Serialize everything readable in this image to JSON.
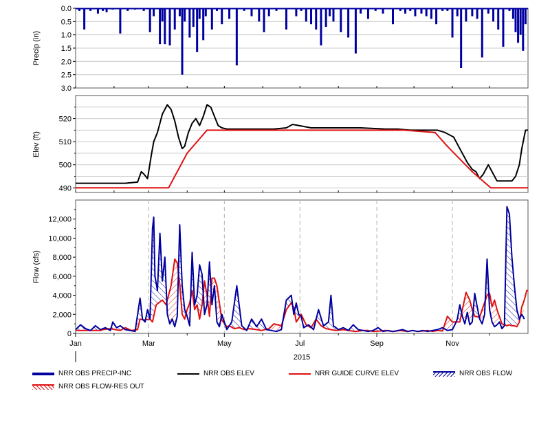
{
  "year_label": "2015",
  "x_months": [
    "Jan",
    "Mar",
    "May",
    "Jul",
    "Sep",
    "Nov"
  ],
  "legend": [
    {
      "label": "NRR OBS PRECIP-INC",
      "style": "thick-line",
      "color": "#0000a0"
    },
    {
      "label": "NRR OBS ELEV",
      "style": "line",
      "color": "#000000"
    },
    {
      "label": "NRR GUIDE CURVE ELEV",
      "style": "line",
      "color": "#e01010"
    },
    {
      "label": "NRR OBS FLOW",
      "style": "hatch",
      "color": "#0000a0"
    },
    {
      "label": "NRR OBS FLOW-RES OUT",
      "style": "hatch",
      "color": "#e01010"
    }
  ],
  "chart_data": [
    {
      "type": "bar",
      "ylabel": "Precip (in)",
      "y_inverted": true,
      "ylim": [
        0,
        3.0
      ],
      "yticks": [
        "0.0",
        "0.5",
        "1.0",
        "1.5",
        "2.0",
        "2.5",
        "3.0"
      ],
      "xlim_days": [
        0,
        365
      ],
      "color": "#0000a0",
      "x_day": [
        3,
        7,
        12,
        18,
        22,
        25,
        30,
        36,
        42,
        48,
        55,
        60,
        63,
        68,
        70,
        72,
        76,
        80,
        84,
        86,
        88,
        92,
        95,
        98,
        100,
        103,
        105,
        110,
        114,
        118,
        124,
        130,
        136,
        142,
        148,
        152,
        156,
        162,
        170,
        178,
        182,
        186,
        190,
        194,
        198,
        202,
        205,
        208,
        214,
        220,
        226,
        230,
        236,
        242,
        248,
        256,
        262,
        266,
        270,
        274,
        279,
        283,
        287,
        291,
        296,
        300,
        304,
        308,
        311,
        315,
        320,
        324,
        328,
        333,
        337,
        341,
        345,
        350,
        353,
        355,
        357,
        359,
        361,
        363
      ],
      "values": [
        0.1,
        0.8,
        0.1,
        0.2,
        0.1,
        0.15,
        0.05,
        0.95,
        0.1,
        0.05,
        0.1,
        0.9,
        0.3,
        1.35,
        0.5,
        1.35,
        1.4,
        0.8,
        0.3,
        2.5,
        0.5,
        1.1,
        0.7,
        1.65,
        0.4,
        1.2,
        0.3,
        0.8,
        0.1,
        0.6,
        0.4,
        2.15,
        0.1,
        0.3,
        0.5,
        0.9,
        0.3,
        0.1,
        0.8,
        0.3,
        0.1,
        0.5,
        0.6,
        0.8,
        1.4,
        0.7,
        0.3,
        0.5,
        0.9,
        1.1,
        1.7,
        0.2,
        0.4,
        0.1,
        0.2,
        0.6,
        0.1,
        0.2,
        0.1,
        0.3,
        0.2,
        0.3,
        0.4,
        0.6,
        0.1,
        0.1,
        1.1,
        0.3,
        2.25,
        0.5,
        0.3,
        0.4,
        1.85,
        0.2,
        0.5,
        0.8,
        1.45,
        0.1,
        0.4,
        0.9,
        1.3,
        1.0,
        1.6,
        0.6
      ]
    },
    {
      "type": "line",
      "ylabel": "Elev (ft)",
      "ylim": [
        488,
        530
      ],
      "yticks": [
        490,
        500,
        510,
        520
      ],
      "xlim_days": [
        0,
        365
      ],
      "series": [
        {
          "color": "#000000",
          "x_day": [
            0,
            20,
            40,
            50,
            53,
            55,
            58,
            61,
            63,
            66,
            70,
            74,
            77,
            80,
            83,
            86,
            88,
            91,
            94,
            97,
            100,
            103,
            106,
            109,
            112,
            115,
            118,
            122,
            130,
            140,
            160,
            170,
            175,
            180,
            190,
            210,
            230,
            250,
            260,
            270,
            280,
            292,
            298,
            305,
            310,
            316,
            320,
            323,
            326,
            329,
            333,
            340,
            348,
            352,
            355,
            358,
            360,
            363,
            365
          ],
          "values": [
            492,
            492,
            492,
            492.5,
            497,
            496,
            494,
            504,
            510,
            514,
            522,
            526,
            524,
            519,
            512,
            507,
            508,
            514,
            518,
            520,
            517,
            521,
            526,
            525,
            521,
            517,
            516,
            515.5,
            515.5,
            515.5,
            515.5,
            516,
            517.5,
            517,
            516,
            516,
            516,
            515.5,
            515.5,
            515,
            515,
            515,
            514,
            512,
            507,
            501,
            498,
            497,
            494,
            496,
            500,
            493,
            493,
            493,
            495,
            500,
            507,
            515,
            515
          ]
        },
        {
          "color": "#e01010",
          "x_day": [
            0,
            75,
            80,
            90,
            106,
            170,
            265,
            290,
            300,
            320,
            335,
            365
          ],
          "values": [
            490,
            490,
            495,
            505,
            515,
            515,
            515,
            514,
            508,
            497,
            490,
            490
          ]
        }
      ]
    },
    {
      "type": "area",
      "ylabel": "Flow (cfs)",
      "ylim": [
        0,
        14000
      ],
      "yticks": [
        "0",
        "2,000",
        "4,000",
        "6,000",
        "8,000",
        "10,000",
        "12,000"
      ],
      "xlim_days": [
        0,
        365
      ],
      "series": [
        {
          "color": "#0000a0",
          "x_day": [
            0,
            4,
            8,
            12,
            16,
            20,
            24,
            28,
            30,
            33,
            36,
            40,
            44,
            48,
            52,
            54,
            56,
            58,
            60,
            62,
            63,
            64,
            66,
            68,
            70,
            72,
            74,
            76,
            78,
            80,
            82,
            84,
            86,
            88,
            90,
            92,
            94,
            96,
            98,
            100,
            102,
            104,
            106,
            108,
            110,
            112,
            114,
            116,
            118,
            122,
            126,
            130,
            134,
            138,
            142,
            146,
            150,
            154,
            158,
            162,
            166,
            170,
            174,
            176,
            178,
            180,
            182,
            184,
            188,
            192,
            196,
            200,
            204,
            206,
            208,
            212,
            216,
            220,
            224,
            228,
            232,
            236,
            240,
            244,
            248,
            252,
            256,
            260,
            264,
            268,
            272,
            276,
            280,
            284,
            288,
            292,
            296,
            300,
            304,
            306,
            308,
            310,
            312,
            314,
            316,
            318,
            320,
            322,
            324,
            326,
            328,
            330,
            332,
            334,
            336,
            338,
            340,
            342,
            344,
            346,
            348,
            350,
            352,
            354,
            356,
            358,
            360,
            362,
            364,
            365
          ],
          "values": [
            400,
            900,
            500,
            300,
            800,
            400,
            600,
            300,
            1200,
            600,
            800,
            400,
            300,
            200,
            3700,
            1500,
            1200,
            2500,
            1500,
            11000,
            12200,
            6000,
            4500,
            10500,
            5500,
            8000,
            2000,
            1000,
            1500,
            700,
            1800,
            11400,
            5000,
            2500,
            1800,
            800,
            8500,
            3000,
            4000,
            7200,
            6200,
            2000,
            3000,
            7500,
            3000,
            5000,
            1200,
            700,
            2000,
            400,
            1200,
            5000,
            800,
            300,
            1500,
            700,
            1500,
            400,
            300,
            200,
            400,
            3500,
            4000,
            2000,
            3200,
            2000,
            1800,
            600,
            900,
            400,
            2500,
            800,
            1200,
            4000,
            800,
            400,
            600,
            300,
            900,
            400,
            300,
            200,
            300,
            600,
            200,
            300,
            200,
            300,
            400,
            200,
            300,
            200,
            300,
            200,
            300,
            400,
            600,
            300,
            400,
            900,
            1500,
            3000,
            1800,
            1000,
            2200,
            900,
            1200,
            4200,
            2800,
            1500,
            1000,
            2000,
            7800,
            2500,
            1200,
            700,
            900,
            1200,
            500,
            800,
            13300,
            12500,
            8000,
            5000,
            2500,
            1500,
            2000,
            1500
          ],
          "region_fill": "hatch"
        },
        {
          "color": "#e01010",
          "x_day": [
            0,
            20,
            22,
            28,
            32,
            36,
            40,
            45,
            50,
            52,
            55,
            60,
            62,
            65,
            70,
            73,
            77,
            80,
            82,
            84,
            86,
            88,
            90,
            92,
            94,
            96,
            98,
            100,
            102,
            104,
            106,
            108,
            110,
            112,
            114,
            118,
            122,
            124,
            128,
            132,
            136,
            140,
            146,
            150,
            156,
            160,
            166,
            170,
            174,
            176,
            178,
            182,
            186,
            190,
            194,
            198,
            202,
            206,
            210,
            216,
            220,
            226,
            232,
            236,
            240,
            246,
            250,
            256,
            262,
            268,
            272,
            276,
            280,
            284,
            288,
            292,
            296,
            300,
            304,
            308,
            310,
            312,
            315,
            318,
            320,
            322,
            326,
            328,
            332,
            334,
            336,
            338,
            340,
            344,
            348,
            350,
            352,
            354,
            356,
            358,
            360,
            362,
            364,
            365
          ],
          "values": [
            300,
            300,
            400,
            500,
            400,
            300,
            600,
            300,
            400,
            1500,
            1400,
            1500,
            1200,
            3000,
            3500,
            3000,
            5000,
            7800,
            7400,
            5200,
            2000,
            1500,
            2500,
            3200,
            4500,
            2500,
            3000,
            1500,
            3000,
            5500,
            4000,
            1800,
            5800,
            5800,
            5000,
            1400,
            700,
            800,
            500,
            600,
            400,
            500,
            400,
            300,
            500,
            1000,
            800,
            2500,
            3200,
            2700,
            1200,
            2000,
            900,
            600,
            1500,
            800,
            500,
            400,
            300,
            400,
            300,
            200,
            300,
            300,
            200,
            250,
            300,
            200,
            300,
            200,
            300,
            200,
            250,
            300,
            200,
            300,
            250,
            1800,
            1200,
            1200,
            1200,
            2500,
            4300,
            3500,
            2500,
            1800,
            1700,
            2500,
            4000,
            4200,
            2800,
            3500,
            2500,
            1000,
            800,
            900,
            800,
            800,
            700,
            1200,
            2800,
            3500,
            4500,
            4500
          ],
          "region_fill": "hatch"
        }
      ]
    }
  ]
}
